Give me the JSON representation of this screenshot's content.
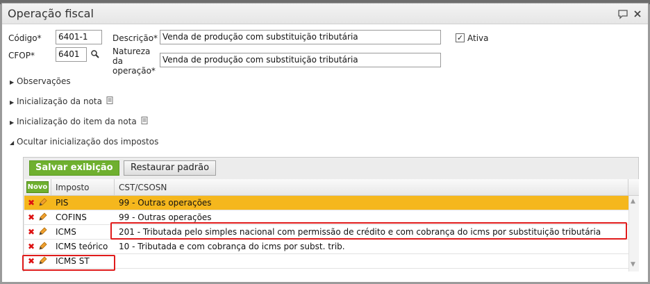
{
  "form": {
    "title": "Operação fiscal",
    "codigo_label": "Código*",
    "codigo_value": "6401-1",
    "cfop_label": "CFOP*",
    "cfop_value": "6401",
    "descricao_label": "Descrição*",
    "descricao_value": "Venda de produção com substituição tributária",
    "natureza_label_1": "Natureza",
    "natureza_label_2": "da",
    "natureza_label_3": "operação*",
    "natureza_value": "Venda de produção com substituição tributária",
    "ativa_label": "Ativa",
    "ativa_checked": true
  },
  "sections": [
    {
      "label": "Observações",
      "expanded": false
    },
    {
      "label": "Inicialização da nota",
      "expanded": false
    },
    {
      "label": "Inicialização do item da nota",
      "expanded": false
    },
    {
      "label": "Ocultar inicialização dos impostos",
      "expanded": true
    }
  ],
  "taxes": {
    "save_label": "Salvar exibição",
    "restore_label": "Restaurar padrão",
    "new_label": "Novo",
    "columns": [
      "Imposto",
      "CST/CSOSN"
    ],
    "rows": [
      {
        "imposto": "PIS",
        "cst": "99 - Outras operações",
        "selected": true
      },
      {
        "imposto": "COFINS",
        "cst": "99 - Outras operações",
        "selected": false
      },
      {
        "imposto": "ICMS",
        "cst": "201 - Tributada pelo simples nacional com permissão de crédito e com cobrança do icms por substituição tributária",
        "selected": false
      },
      {
        "imposto": "ICMS teórico",
        "cst": "10 - Tributada e com cobrança do icms por subst. trib.",
        "selected": false
      },
      {
        "imposto": "ICMS ST",
        "cst": "",
        "selected": false
      }
    ]
  },
  "colors": {
    "accent_green": "#6fb02f",
    "selected_row": "#f5b71d",
    "highlight_red": "#e01b1b"
  },
  "icons": {
    "comment": "speech-bubble-icon",
    "close": "close-icon",
    "search": "magnifier-icon",
    "delete": "red-x-icon",
    "edit": "pencil-icon",
    "note": "document-icon"
  }
}
